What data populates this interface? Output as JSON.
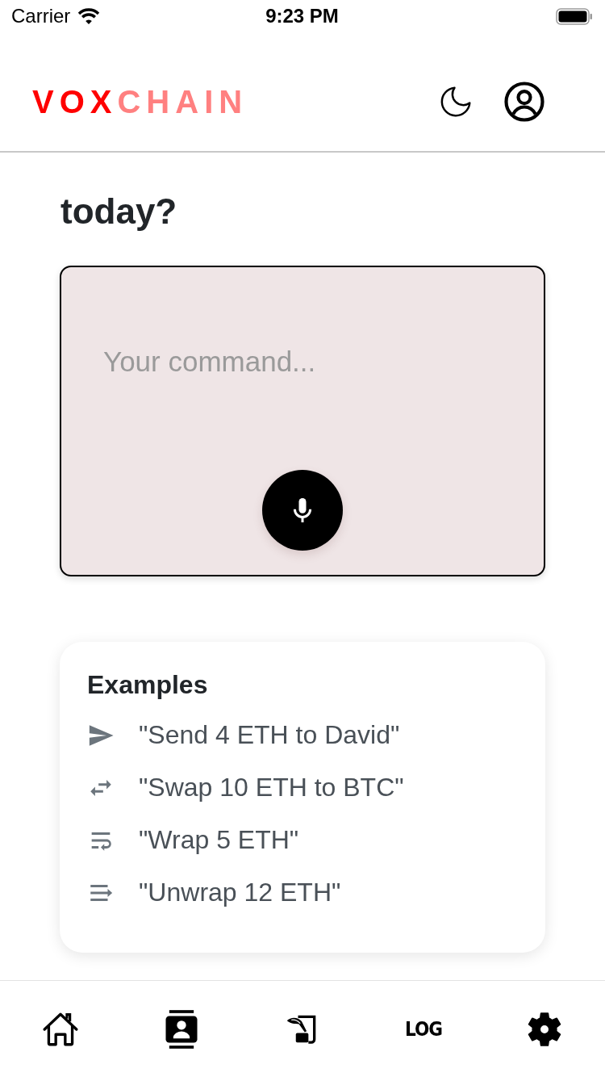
{
  "status_bar": {
    "carrier": "Carrier",
    "time": "9:23 PM"
  },
  "header": {
    "logo": [
      {
        "text": "VOX",
        "color": "#ff0000"
      },
      {
        "text": "CHAIN",
        "color": "#ff8080"
      }
    ]
  },
  "prompt": {
    "title": "today?"
  },
  "command": {
    "placeholder": "Your command..."
  },
  "examples": {
    "title": "Examples",
    "items": [
      {
        "kind": "send",
        "text": "\"Send 4 ETH to David\""
      },
      {
        "kind": "swap",
        "text": "\"Swap 10 ETH to BTC\""
      },
      {
        "kind": "wrap",
        "text": "\"Wrap 5 ETH\""
      },
      {
        "kind": "unwrap",
        "text": "\"Unwrap 12 ETH\""
      }
    ]
  },
  "bottom_nav": {
    "log_label": "LOG"
  }
}
